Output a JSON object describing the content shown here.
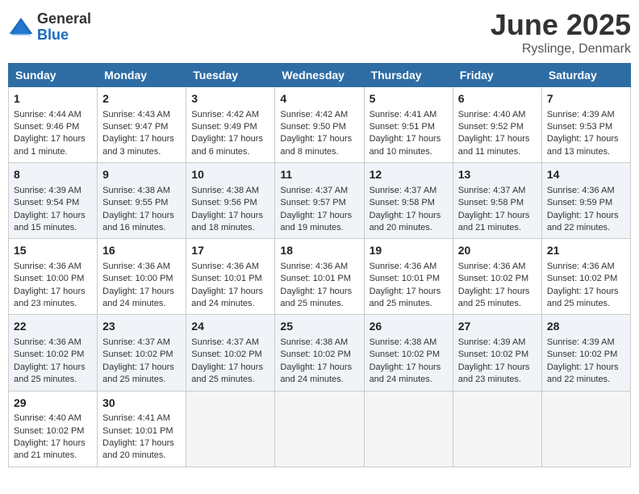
{
  "logo": {
    "general": "General",
    "blue": "Blue"
  },
  "header": {
    "title": "June 2025",
    "location": "Ryslinge, Denmark"
  },
  "weekdays": [
    "Sunday",
    "Monday",
    "Tuesday",
    "Wednesday",
    "Thursday",
    "Friday",
    "Saturday"
  ],
  "weeks": [
    [
      {
        "day": "1",
        "sunrise": "4:44 AM",
        "sunset": "9:46 PM",
        "daylight": "17 hours and 1 minute."
      },
      {
        "day": "2",
        "sunrise": "4:43 AM",
        "sunset": "9:47 PM",
        "daylight": "17 hours and 3 minutes."
      },
      {
        "day": "3",
        "sunrise": "4:42 AM",
        "sunset": "9:49 PM",
        "daylight": "17 hours and 6 minutes."
      },
      {
        "day": "4",
        "sunrise": "4:42 AM",
        "sunset": "9:50 PM",
        "daylight": "17 hours and 8 minutes."
      },
      {
        "day": "5",
        "sunrise": "4:41 AM",
        "sunset": "9:51 PM",
        "daylight": "17 hours and 10 minutes."
      },
      {
        "day": "6",
        "sunrise": "4:40 AM",
        "sunset": "9:52 PM",
        "daylight": "17 hours and 11 minutes."
      },
      {
        "day": "7",
        "sunrise": "4:39 AM",
        "sunset": "9:53 PM",
        "daylight": "17 hours and 13 minutes."
      }
    ],
    [
      {
        "day": "8",
        "sunrise": "4:39 AM",
        "sunset": "9:54 PM",
        "daylight": "17 hours and 15 minutes."
      },
      {
        "day": "9",
        "sunrise": "4:38 AM",
        "sunset": "9:55 PM",
        "daylight": "17 hours and 16 minutes."
      },
      {
        "day": "10",
        "sunrise": "4:38 AM",
        "sunset": "9:56 PM",
        "daylight": "17 hours and 18 minutes."
      },
      {
        "day": "11",
        "sunrise": "4:37 AM",
        "sunset": "9:57 PM",
        "daylight": "17 hours and 19 minutes."
      },
      {
        "day": "12",
        "sunrise": "4:37 AM",
        "sunset": "9:58 PM",
        "daylight": "17 hours and 20 minutes."
      },
      {
        "day": "13",
        "sunrise": "4:37 AM",
        "sunset": "9:58 PM",
        "daylight": "17 hours and 21 minutes."
      },
      {
        "day": "14",
        "sunrise": "4:36 AM",
        "sunset": "9:59 PM",
        "daylight": "17 hours and 22 minutes."
      }
    ],
    [
      {
        "day": "15",
        "sunrise": "4:36 AM",
        "sunset": "10:00 PM",
        "daylight": "17 hours and 23 minutes."
      },
      {
        "day": "16",
        "sunrise": "4:36 AM",
        "sunset": "10:00 PM",
        "daylight": "17 hours and 24 minutes."
      },
      {
        "day": "17",
        "sunrise": "4:36 AM",
        "sunset": "10:01 PM",
        "daylight": "17 hours and 24 minutes."
      },
      {
        "day": "18",
        "sunrise": "4:36 AM",
        "sunset": "10:01 PM",
        "daylight": "17 hours and 25 minutes."
      },
      {
        "day": "19",
        "sunrise": "4:36 AM",
        "sunset": "10:01 PM",
        "daylight": "17 hours and 25 minutes."
      },
      {
        "day": "20",
        "sunrise": "4:36 AM",
        "sunset": "10:02 PM",
        "daylight": "17 hours and 25 minutes."
      },
      {
        "day": "21",
        "sunrise": "4:36 AM",
        "sunset": "10:02 PM",
        "daylight": "17 hours and 25 minutes."
      }
    ],
    [
      {
        "day": "22",
        "sunrise": "4:36 AM",
        "sunset": "10:02 PM",
        "daylight": "17 hours and 25 minutes."
      },
      {
        "day": "23",
        "sunrise": "4:37 AM",
        "sunset": "10:02 PM",
        "daylight": "17 hours and 25 minutes."
      },
      {
        "day": "24",
        "sunrise": "4:37 AM",
        "sunset": "10:02 PM",
        "daylight": "17 hours and 25 minutes."
      },
      {
        "day": "25",
        "sunrise": "4:38 AM",
        "sunset": "10:02 PM",
        "daylight": "17 hours and 24 minutes."
      },
      {
        "day": "26",
        "sunrise": "4:38 AM",
        "sunset": "10:02 PM",
        "daylight": "17 hours and 24 minutes."
      },
      {
        "day": "27",
        "sunrise": "4:39 AM",
        "sunset": "10:02 PM",
        "daylight": "17 hours and 23 minutes."
      },
      {
        "day": "28",
        "sunrise": "4:39 AM",
        "sunset": "10:02 PM",
        "daylight": "17 hours and 22 minutes."
      }
    ],
    [
      {
        "day": "29",
        "sunrise": "4:40 AM",
        "sunset": "10:02 PM",
        "daylight": "17 hours and 21 minutes."
      },
      {
        "day": "30",
        "sunrise": "4:41 AM",
        "sunset": "10:01 PM",
        "daylight": "17 hours and 20 minutes."
      },
      null,
      null,
      null,
      null,
      null
    ]
  ],
  "labels": {
    "sunrise": "Sunrise:",
    "sunset": "Sunset:",
    "daylight": "Daylight:"
  }
}
